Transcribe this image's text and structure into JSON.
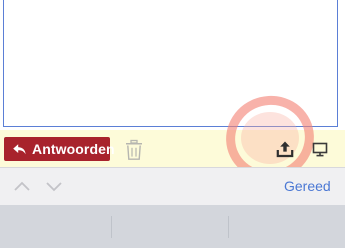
{
  "action_bar": {
    "reply_label": "Antwoorden",
    "reply_icon": "reply-arrow-icon",
    "trash_icon": "trash-icon",
    "upload_icon": "upload-icon",
    "display_icon": "display-icon"
  },
  "keyboard_toolbar": {
    "up_icon": "chevron-up-icon",
    "down_icon": "chevron-down-icon",
    "done_label": "Gereed"
  },
  "colors": {
    "reply_button": "#a8232c",
    "action_bar_background": "#fdfbd9",
    "done_text": "#4b78d4",
    "highlight": "#f38276",
    "compose_border": "#5b7fd6"
  }
}
